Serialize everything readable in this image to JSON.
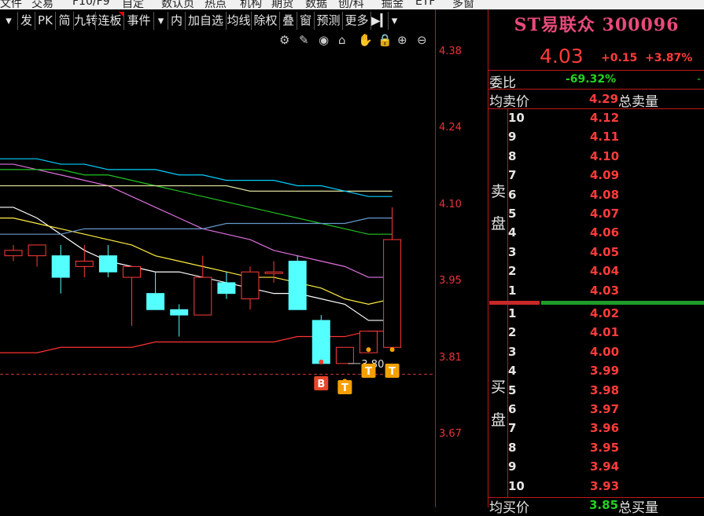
{
  "topbar": [
    "文件",
    "交易",
    "F10/F9",
    "自定",
    "数认页",
    "热点",
    "机构",
    "期货",
    "数据",
    "创/科",
    "掘金",
    "ETF",
    "多窗"
  ],
  "toolbar": {
    "buttons": [
      {
        "label": "发",
        "red": false
      },
      {
        "label": "PK",
        "red": false
      },
      {
        "label": "简",
        "red": false
      },
      {
        "label": "九转",
        "red": false
      },
      {
        "label": "连板",
        "red": true
      },
      {
        "label": "事件",
        "red": false
      },
      {
        "label": "▾",
        "red": false
      },
      {
        "label": "内",
        "red": false
      },
      {
        "label": "加自选",
        "red": false
      },
      {
        "label": "均线",
        "red": false
      },
      {
        "label": "除权",
        "red": false
      },
      {
        "label": "叠",
        "red": false
      },
      {
        "label": "窗",
        "red": false
      },
      {
        "label": "预测",
        "red": false
      },
      {
        "label": "更多",
        "red": false
      },
      {
        "label": "▶▎",
        "red": false
      },
      {
        "label": "▾",
        "red": false
      }
    ],
    "left_arrow": "▾"
  },
  "chart_tools": [
    "gear-icon",
    "pen-icon",
    "eye-icon",
    "basket-icon",
    "hand-icon",
    "lock-icon",
    "zoom-in-icon",
    "zoom-out-icon"
  ],
  "chart_tool_glyphs": [
    "⚙",
    "✎",
    "◉",
    "⌂",
    "✋",
    "🔒",
    "⊕",
    "⊖"
  ],
  "chart_data": {
    "type": "candlestick",
    "y_ticks": [
      "4.38",
      "4.24",
      "4.10",
      "3.95",
      "3.81",
      "3.67"
    ],
    "ylim": [
      3.62,
      4.45
    ],
    "dashed_line_value": 3.78,
    "min_label": "3.80",
    "candles": [
      {
        "o": 4.0,
        "h": 4.02,
        "l": 3.99,
        "c": 4.01
      },
      {
        "o": 4.0,
        "h": 4.02,
        "l": 3.98,
        "c": 4.02
      },
      {
        "o": 4.0,
        "h": 4.02,
        "l": 3.93,
        "c": 3.96
      },
      {
        "o": 3.98,
        "h": 4.02,
        "l": 3.96,
        "c": 3.99
      },
      {
        "o": 4.0,
        "h": 4.02,
        "l": 3.96,
        "c": 3.97
      },
      {
        "o": 3.96,
        "h": 3.98,
        "l": 3.87,
        "c": 3.98
      },
      {
        "o": 3.93,
        "h": 3.97,
        "l": 3.91,
        "c": 3.9
      },
      {
        "o": 3.9,
        "h": 3.91,
        "l": 3.85,
        "c": 3.89
      },
      {
        "o": 3.89,
        "h": 4.0,
        "l": 3.89,
        "c": 3.96
      },
      {
        "o": 3.95,
        "h": 3.97,
        "l": 3.92,
        "c": 3.93
      },
      {
        "o": 3.92,
        "h": 3.98,
        "l": 3.9,
        "c": 3.97
      },
      {
        "o": 3.97,
        "h": 3.99,
        "l": 3.95,
        "c": 3.97
      },
      {
        "o": 3.99,
        "h": 4.0,
        "l": 3.9,
        "c": 3.9
      },
      {
        "o": 3.88,
        "h": 3.89,
        "l": 3.81,
        "c": 3.8
      },
      {
        "o": 3.8,
        "h": 3.83,
        "l": 3.8,
        "c": 3.83
      },
      {
        "o": 3.82,
        "h": 3.86,
        "l": 3.82,
        "c": 3.86
      },
      {
        "o": 3.83,
        "h": 4.09,
        "l": 3.83,
        "c": 4.03
      }
    ],
    "moving_averages": [
      {
        "color": "#ffffff",
        "values": [
          4.09,
          4.07,
          4.04,
          4.01,
          3.99,
          3.98,
          3.97,
          3.97,
          3.96,
          3.95,
          3.94,
          3.93,
          3.93,
          3.92,
          3.91,
          3.88,
          3.88
        ]
      },
      {
        "color": "#ffee44",
        "values": [
          4.07,
          4.06,
          4.05,
          4.04,
          4.03,
          4.02,
          4.0,
          3.99,
          3.98,
          3.97,
          3.96,
          3.96,
          3.95,
          3.94,
          3.92,
          3.91,
          3.92
        ]
      },
      {
        "color": "#e070e0",
        "values": [
          4.17,
          4.16,
          4.15,
          4.14,
          4.13,
          4.11,
          4.09,
          4.07,
          4.05,
          4.04,
          4.03,
          4.01,
          4.0,
          3.99,
          3.98,
          3.96,
          3.96
        ]
      },
      {
        "color": "#22c322",
        "values": [
          4.16,
          4.16,
          4.16,
          4.15,
          4.15,
          4.14,
          4.13,
          4.12,
          4.11,
          4.1,
          4.09,
          4.08,
          4.07,
          4.06,
          4.05,
          4.04,
          4.04
        ]
      },
      {
        "color": "#dddd99",
        "values": [
          4.13,
          4.13,
          4.13,
          4.13,
          4.13,
          4.13,
          4.13,
          4.13,
          4.13,
          4.13,
          4.12,
          4.12,
          4.12,
          4.12,
          4.12,
          4.12,
          4.12
        ]
      },
      {
        "color": "#00cfff",
        "values": [
          4.18,
          4.18,
          4.17,
          4.17,
          4.16,
          4.16,
          4.16,
          4.15,
          4.15,
          4.14,
          4.14,
          4.14,
          4.13,
          4.13,
          4.12,
          4.11,
          4.11
        ]
      },
      {
        "color": "#6699cc",
        "values": [
          4.04,
          4.04,
          4.04,
          4.05,
          4.05,
          4.05,
          4.05,
          4.05,
          4.05,
          4.06,
          4.06,
          4.06,
          4.06,
          4.06,
          4.06,
          4.07,
          4.07
        ]
      },
      {
        "color": "#ff3333",
        "values": [
          3.82,
          3.82,
          3.83,
          3.83,
          3.83,
          3.83,
          3.84,
          3.84,
          3.84,
          3.84,
          3.84,
          3.84,
          3.85,
          3.85,
          3.85,
          3.86,
          3.86
        ]
      }
    ],
    "signals": [
      {
        "index": 13,
        "label": "B",
        "color": "#e8452a"
      },
      {
        "index": 14,
        "label": "T",
        "color": "#f5a000"
      },
      {
        "index": 15,
        "label": "T",
        "color": "#f5a000"
      },
      {
        "index": 16,
        "label": "T",
        "color": "#f5a000"
      }
    ]
  },
  "quote": {
    "title": "ST易联众 300096",
    "last": "4.03",
    "change": "+0.15",
    "change_pct": "+3.87%",
    "weibi_label": "委比",
    "weibi_value": "-69.32%",
    "weibi_extra": "-",
    "avg_sell_label": "均卖价",
    "avg_sell_value": "4.29",
    "total_sell_label": "总卖量",
    "avg_buy_label": "均买价",
    "avg_buy_value": "3.85",
    "total_buy_label": "总买量",
    "sell_side": [
      "卖",
      "盘"
    ],
    "buy_side": [
      "买",
      "盘"
    ],
    "sell": [
      {
        "lvl": "10",
        "px": "4.12"
      },
      {
        "lvl": "9",
        "px": "4.11"
      },
      {
        "lvl": "8",
        "px": "4.10"
      },
      {
        "lvl": "7",
        "px": "4.09"
      },
      {
        "lvl": "6",
        "px": "4.08"
      },
      {
        "lvl": "5",
        "px": "4.07"
      },
      {
        "lvl": "4",
        "px": "4.06"
      },
      {
        "lvl": "3",
        "px": "4.05"
      },
      {
        "lvl": "2",
        "px": "4.04"
      },
      {
        "lvl": "1",
        "px": "4.03"
      }
    ],
    "buy": [
      {
        "lvl": "1",
        "px": "4.02"
      },
      {
        "lvl": "2",
        "px": "4.01"
      },
      {
        "lvl": "3",
        "px": "4.00"
      },
      {
        "lvl": "4",
        "px": "3.99"
      },
      {
        "lvl": "5",
        "px": "3.98"
      },
      {
        "lvl": "6",
        "px": "3.97"
      },
      {
        "lvl": "7",
        "px": "3.96"
      },
      {
        "lvl": "8",
        "px": "3.95"
      },
      {
        "lvl": "9",
        "px": "3.94"
      },
      {
        "lvl": "10",
        "px": "3.93"
      }
    ]
  }
}
